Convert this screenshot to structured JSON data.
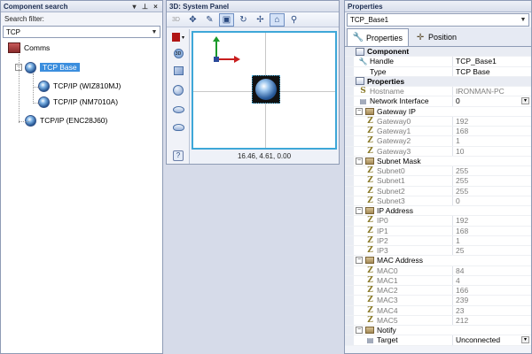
{
  "component_search": {
    "title": "Component search",
    "filter_label": "Search filter:",
    "filter_value": "TCP",
    "tree": [
      {
        "label": "Comms",
        "icon": "comms-icon",
        "level": 0,
        "expander": ""
      },
      {
        "label": "TCP Base",
        "icon": "globe-icon",
        "level": 1,
        "expander": "−",
        "selected": true
      },
      {
        "label": "TCP/IP (WIZ810MJ)",
        "icon": "globe-icon",
        "level": 2,
        "expander": ""
      },
      {
        "label": "TCP/IP (NM7010A)",
        "icon": "globe-icon",
        "level": 2,
        "expander": ""
      },
      {
        "label": "TCP/IP (ENC28J60)",
        "icon": "globe-icon",
        "level": 1,
        "expander": ""
      }
    ]
  },
  "system_panel": {
    "title": "3D: System Panel",
    "coords": "16.46, 4.61, 0.00"
  },
  "properties": {
    "title": "Properties",
    "selected_object": "TCP_Base1",
    "tabs": [
      {
        "label": "Properties",
        "active": true
      },
      {
        "label": "Position",
        "active": false
      }
    ],
    "rows": [
      {
        "kind": "section",
        "name": "Component",
        "value": ""
      },
      {
        "kind": "item",
        "name": "Handle",
        "value": "TCP_Base1",
        "icon": "wrench-icon"
      },
      {
        "kind": "item",
        "name": "Type",
        "value": "TCP Base",
        "icon": "none"
      },
      {
        "kind": "section",
        "name": "Properties",
        "value": ""
      },
      {
        "kind": "item",
        "name": "Hostname",
        "value": "IRONMAN-PC",
        "icon": "s-icon",
        "disabled": true
      },
      {
        "kind": "item",
        "name": "Network Interface",
        "value": "0",
        "icon": "list-icon",
        "dropdown": true
      },
      {
        "kind": "group",
        "name": "Gateway IP",
        "value": ""
      },
      {
        "kind": "item",
        "name": "Gateway0",
        "value": "192",
        "icon": "z-icon",
        "disabled": true,
        "indent": true
      },
      {
        "kind": "item",
        "name": "Gateway1",
        "value": "168",
        "icon": "z-icon",
        "disabled": true,
        "indent": true
      },
      {
        "kind": "item",
        "name": "Gateway2",
        "value": "1",
        "icon": "z-icon",
        "disabled": true,
        "indent": true
      },
      {
        "kind": "item",
        "name": "Gateway3",
        "value": "10",
        "icon": "z-icon",
        "disabled": true,
        "indent": true
      },
      {
        "kind": "group",
        "name": "Subnet Mask",
        "value": ""
      },
      {
        "kind": "item",
        "name": "Subnet0",
        "value": "255",
        "icon": "z-icon",
        "disabled": true,
        "indent": true
      },
      {
        "kind": "item",
        "name": "Subnet1",
        "value": "255",
        "icon": "z-icon",
        "disabled": true,
        "indent": true
      },
      {
        "kind": "item",
        "name": "Subnet2",
        "value": "255",
        "icon": "z-icon",
        "disabled": true,
        "indent": true
      },
      {
        "kind": "item",
        "name": "Subnet3",
        "value": "0",
        "icon": "z-icon",
        "disabled": true,
        "indent": true
      },
      {
        "kind": "group",
        "name": "IP Address",
        "value": ""
      },
      {
        "kind": "item",
        "name": "IP0",
        "value": "192",
        "icon": "z-icon",
        "disabled": true,
        "indent": true
      },
      {
        "kind": "item",
        "name": "IP1",
        "value": "168",
        "icon": "z-icon",
        "disabled": true,
        "indent": true
      },
      {
        "kind": "item",
        "name": "IP2",
        "value": "1",
        "icon": "z-icon",
        "disabled": true,
        "indent": true
      },
      {
        "kind": "item",
        "name": "IP3",
        "value": "25",
        "icon": "z-icon",
        "disabled": true,
        "indent": true
      },
      {
        "kind": "group",
        "name": "MAC Address",
        "value": ""
      },
      {
        "kind": "item",
        "name": "MAC0",
        "value": "84",
        "icon": "z-icon",
        "disabled": true,
        "indent": true
      },
      {
        "kind": "item",
        "name": "MAC1",
        "value": "4",
        "icon": "z-icon",
        "disabled": true,
        "indent": true
      },
      {
        "kind": "item",
        "name": "MAC2",
        "value": "166",
        "icon": "z-icon",
        "disabled": true,
        "indent": true
      },
      {
        "kind": "item",
        "name": "MAC3",
        "value": "239",
        "icon": "z-icon",
        "disabled": true,
        "indent": true
      },
      {
        "kind": "item",
        "name": "MAC4",
        "value": "23",
        "icon": "z-icon",
        "disabled": true,
        "indent": true
      },
      {
        "kind": "item",
        "name": "MAC5",
        "value": "212",
        "icon": "z-icon",
        "disabled": true,
        "indent": true
      },
      {
        "kind": "group",
        "name": "Notify",
        "value": ""
      },
      {
        "kind": "item",
        "name": "Target",
        "value": "Unconnected",
        "icon": "list-icon",
        "indent": true,
        "dropdown": true
      }
    ]
  }
}
